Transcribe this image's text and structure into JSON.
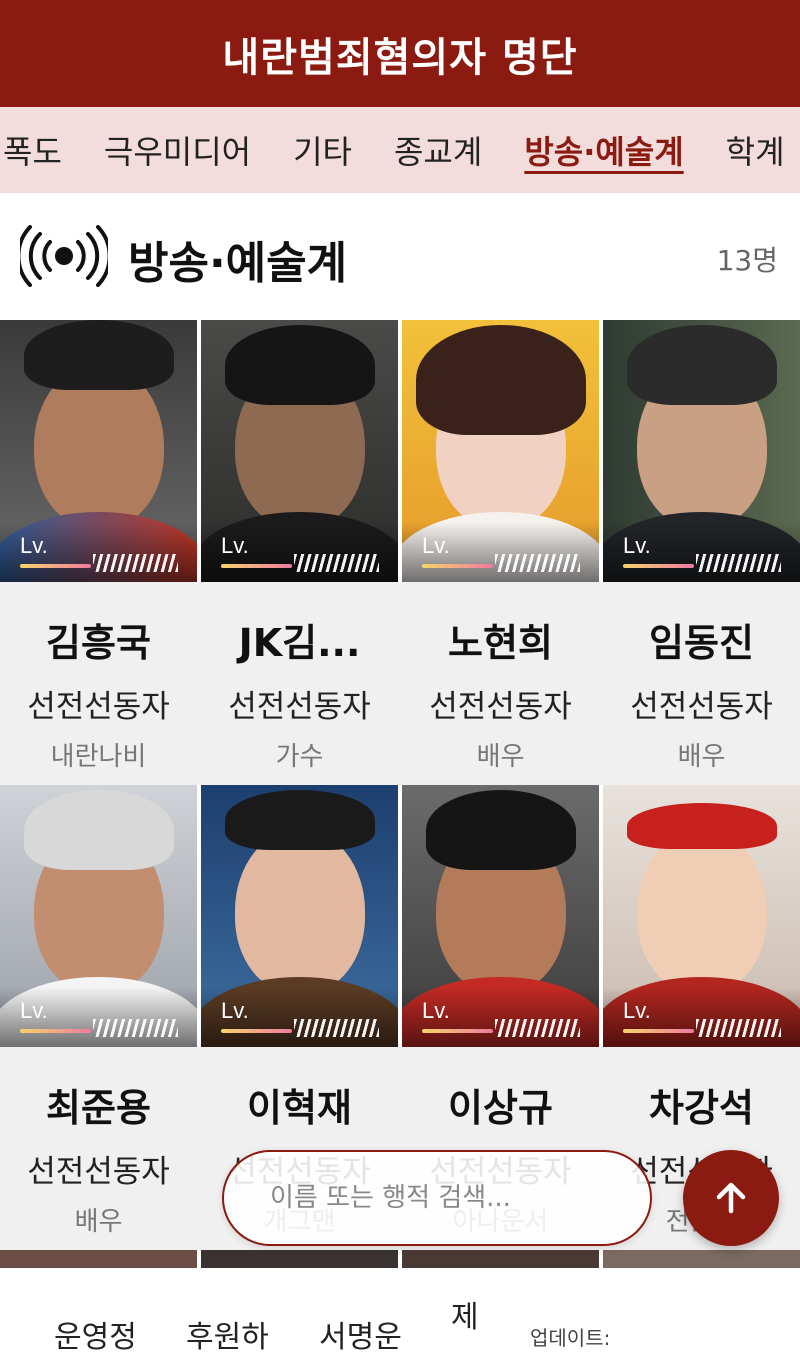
{
  "header": {
    "title": "내란범죄혐의자 명단"
  },
  "categories": {
    "items": [
      "폭도",
      "극우미디어",
      "기타",
      "종교계",
      "방송·예술계",
      "학계"
    ],
    "active": "방송·예술계"
  },
  "section": {
    "title": "방송·예술계",
    "count": "13명",
    "icon": "broadcast-icon"
  },
  "level_label": "Lv.",
  "people": [
    {
      "name": "김흥국",
      "type": "선전선동자",
      "role": "내란나비",
      "level": 0.45
    },
    {
      "name": "JK김...",
      "type": "선전선동자",
      "role": "가수",
      "level": 0.45
    },
    {
      "name": "노현희",
      "type": "선전선동자",
      "role": "배우",
      "level": 0.45
    },
    {
      "name": "임동진",
      "type": "선전선동자",
      "role": "배우",
      "level": 0.45
    },
    {
      "name": "최준용",
      "type": "선전선동자",
      "role": "배우",
      "level": 0.45
    },
    {
      "name": "이혁재",
      "type": "선전선동자",
      "role": "개그맨",
      "level": 0.45
    },
    {
      "name": "이상규",
      "type": "선전선동자",
      "role": "아나운서",
      "level": 0.45
    },
    {
      "name": "차강석",
      "type": "선전선동자",
      "role": "전문가",
      "level": 0.45
    }
  ],
  "search": {
    "placeholder": "이름 또는 행적 검색..."
  },
  "scroll_top": {
    "icon": "arrow-up-icon"
  },
  "bottom_names": [
    "운영정",
    "후원하",
    "서명운",
    "제"
  ],
  "update_label": "업데이트:",
  "colors": {
    "brand": "#8b1a10",
    "tab_bg": "#f3dcdc",
    "card_info_bg": "#f0f0f0"
  }
}
